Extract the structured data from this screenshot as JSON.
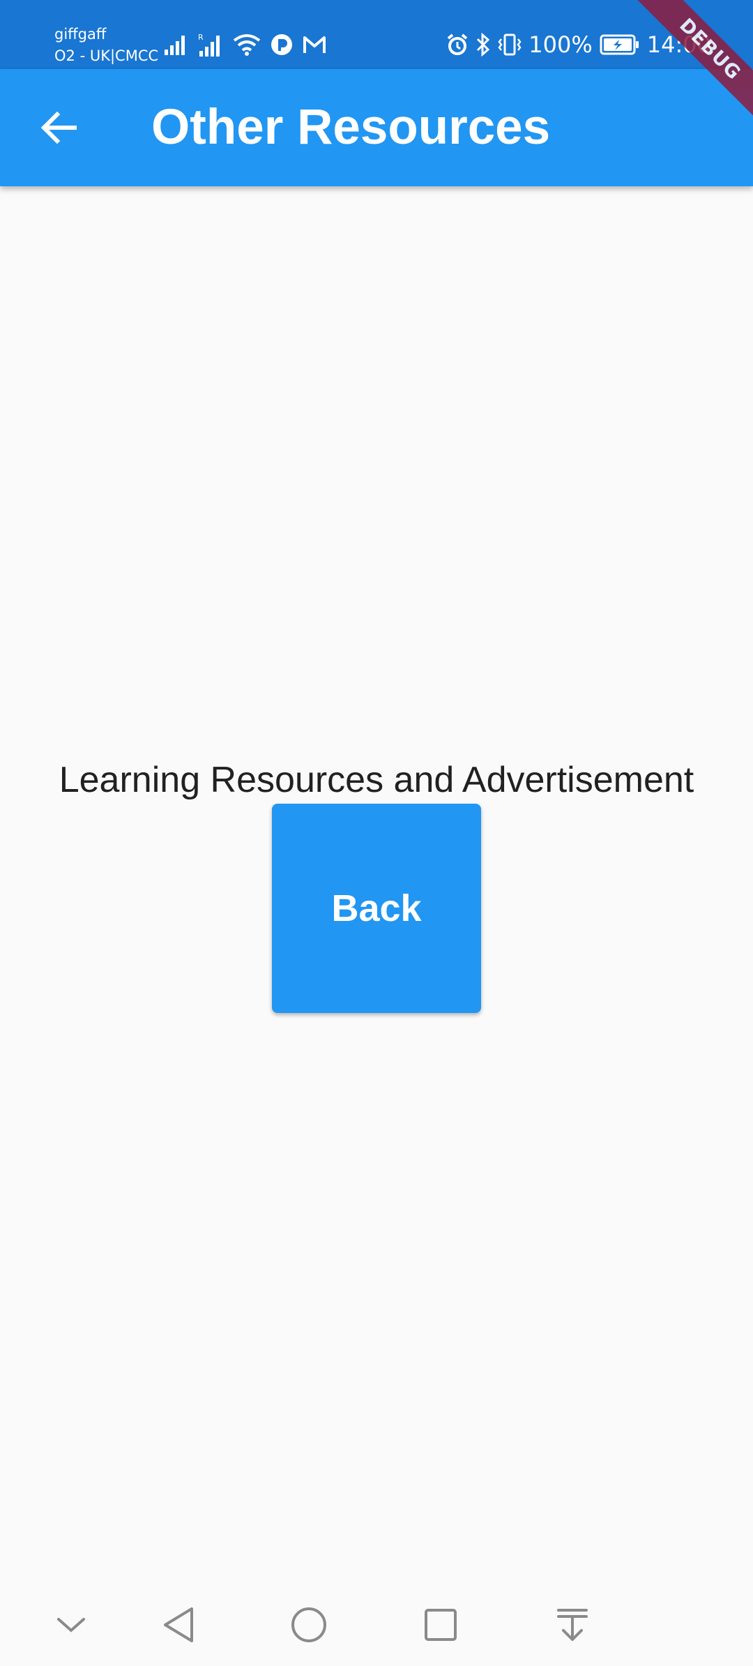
{
  "status_bar": {
    "carrier_primary": "giffgaff",
    "carrier_secondary": "O2 - UK|CMCC",
    "battery_percent": "100%",
    "time": "14:00",
    "icons": [
      "signal-icon",
      "roaming-signal-icon",
      "wifi-icon",
      "notification-app-icon",
      "gmail-icon",
      "alarm-icon",
      "bluetooth-icon",
      "vibrate-icon",
      "battery-charging-icon"
    ]
  },
  "debug_banner": "DEBUG",
  "app_bar": {
    "title": "Other Resources",
    "back_icon": "arrow-back-icon"
  },
  "main": {
    "message": "Learning Resources and Advertisement",
    "back_button_label": "Back"
  },
  "nav_bar": {
    "icons": [
      "chevron-down-icon",
      "back-triangle-icon",
      "home-circle-icon",
      "recents-square-icon",
      "notification-pull-icon"
    ]
  },
  "colors": {
    "status_bar": "#1976d2",
    "primary": "#2196f3",
    "background": "#fafafa",
    "text": "#212121",
    "debug_ribbon": "#8c1d3f",
    "nav_icon": "#8a8a8a"
  }
}
